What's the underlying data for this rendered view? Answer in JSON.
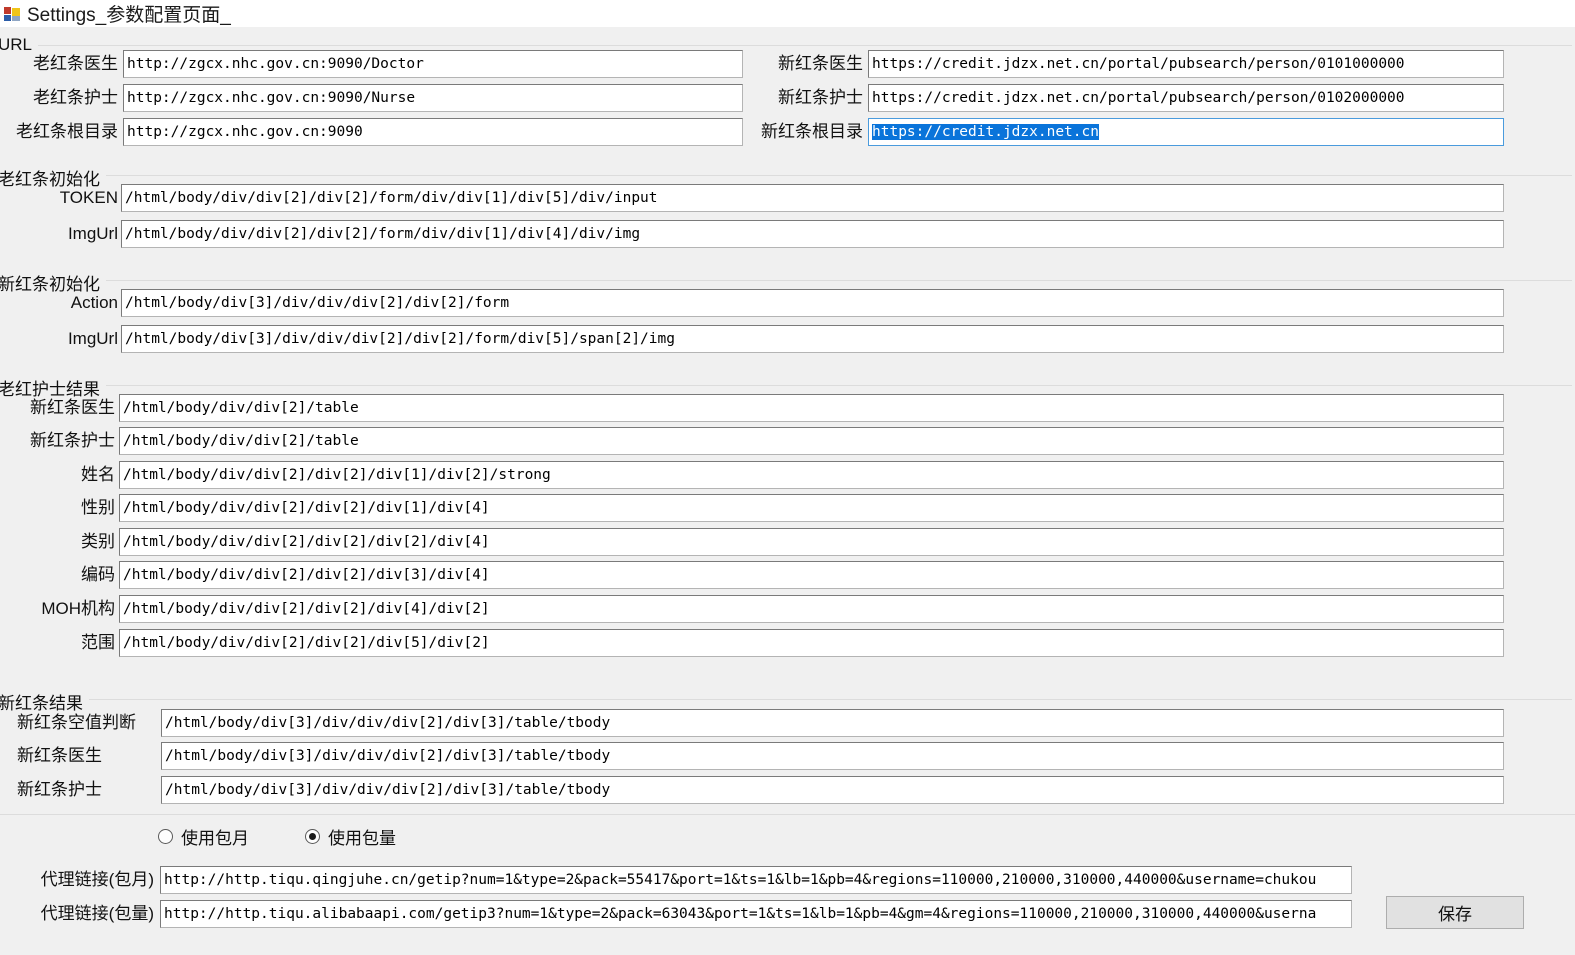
{
  "window": {
    "title": "Settings_参数配置页面_",
    "icon": "app-window-icon"
  },
  "groups": {
    "url": {
      "label": "URL",
      "fields_left": [
        {
          "label": "老红条医生",
          "value": "http://zgcx.nhc.gov.cn:9090/Doctor"
        },
        {
          "label": "老红条护士",
          "value": "http://zgcx.nhc.gov.cn:9090/Nurse"
        },
        {
          "label": "老红条根目录",
          "value": "http://zgcx.nhc.gov.cn:9090"
        }
      ],
      "fields_right": [
        {
          "label": "新红条医生",
          "value": "https://credit.jdzx.net.cn/portal/pubsearch/person/0101000000",
          "focused": false,
          "selected": false
        },
        {
          "label": "新红条护士",
          "value": "https://credit.jdzx.net.cn/portal/pubsearch/person/0102000000",
          "focused": false,
          "selected": false
        },
        {
          "label": "新红条根目录",
          "value": "https://credit.jdzx.net.cn",
          "focused": true,
          "selected": true
        }
      ]
    },
    "old_init": {
      "label": "老红条初始化",
      "fields": [
        {
          "label": "TOKEN",
          "value": "/html/body/div/div[2]/div[2]/form/div/div[1]/div[5]/div/input"
        },
        {
          "label": "ImgUrl",
          "value": "/html/body/div/div[2]/div[2]/form/div/div[1]/div[4]/div/img"
        }
      ]
    },
    "new_init": {
      "label": "新红条初始化",
      "fields": [
        {
          "label": "Action",
          "value": "/html/body/div[3]/div/div/div[2]/div[2]/form"
        },
        {
          "label": "ImgUrl",
          "value": "/html/body/div[3]/div/div/div[2]/div[2]/form/div[5]/span[2]/img"
        }
      ]
    },
    "old_nurse_result": {
      "label": "老红护士结果",
      "fields": [
        {
          "label": "新红条医生",
          "value": "/html/body/div/div[2]/table"
        },
        {
          "label": "新红条护士",
          "value": "/html/body/div/div[2]/table"
        },
        {
          "label": "姓名",
          "value": "/html/body/div/div[2]/div[2]/div[1]/div[2]/strong"
        },
        {
          "label": "性别",
          "value": "/html/body/div/div[2]/div[2]/div[1]/div[4]"
        },
        {
          "label": "类别",
          "value": "/html/body/div/div[2]/div[2]/div[2]/div[4]"
        },
        {
          "label": "编码",
          "value": "/html/body/div/div[2]/div[2]/div[3]/div[4]"
        },
        {
          "label": "MOH机构",
          "value": "/html/body/div/div[2]/div[2]/div[4]/div[2]"
        },
        {
          "label": "范围",
          "value": "/html/body/div/div[2]/div[2]/div[5]/div[2]"
        }
      ]
    },
    "new_result": {
      "label": "新红条结果",
      "fields": [
        {
          "label": "新红条空值判断",
          "value": "/html/body/div[3]/div/div/div[2]/div[3]/table/tbody"
        },
        {
          "label": "新红条医生",
          "value": "/html/body/div[3]/div/div/div[2]/div[3]/table/tbody"
        },
        {
          "label": "新红条护士",
          "value": "/html/body/div[3]/div/div/div[2]/div[3]/table/tbody"
        }
      ]
    }
  },
  "proxy": {
    "radios": [
      {
        "label": "使用包月",
        "checked": false
      },
      {
        "label": "使用包量",
        "checked": true
      }
    ],
    "fields": [
      {
        "label": "代理链接(包月)",
        "value": "http://http.tiqu.qingjuhe.cn/getip?num=1&type=2&pack=55417&port=1&ts=1&lb=1&pb=4&regions=110000,210000,310000,440000&username=chukou"
      },
      {
        "label": "代理链接(包量)",
        "value": "http://http.tiqu.alibabaapi.com/getip3?num=1&type=2&pack=63043&port=1&ts=1&lb=1&pb=4&gm=4&regions=110000,210000,310000,440000&userna"
      }
    ]
  },
  "buttons": {
    "save": "保存"
  },
  "colors": {
    "background": "#f0f0f0",
    "field_background": "#ffffff",
    "focus_border": "#4a9bdd",
    "selection": "#0a74da",
    "titlebar": "#ffffff"
  }
}
